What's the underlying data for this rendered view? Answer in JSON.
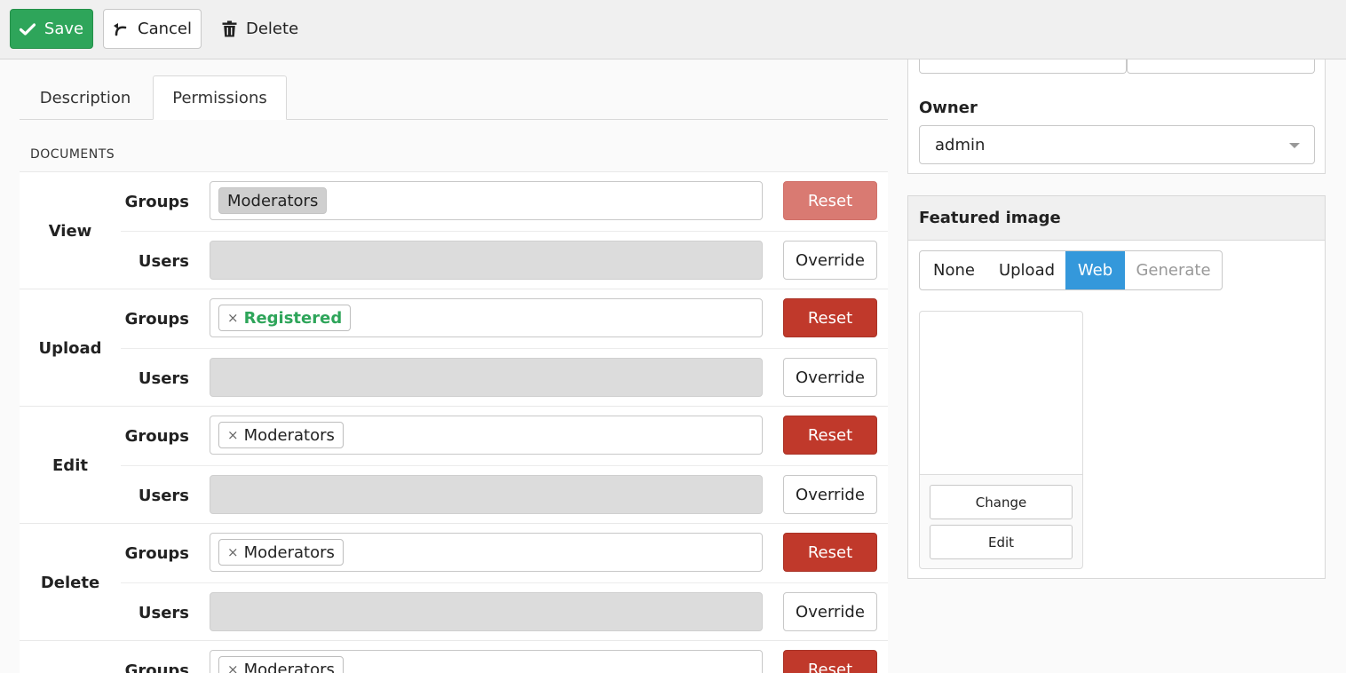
{
  "toolbar": {
    "save_label": "Save",
    "cancel_label": "Cancel",
    "delete_label": "Delete"
  },
  "tabs": [
    {
      "label": "Description",
      "active": false
    },
    {
      "label": "Permissions",
      "active": true
    }
  ],
  "section": {
    "label": "DOCUMENTS"
  },
  "labels": {
    "groups": "Groups",
    "users": "Users"
  },
  "permissions": [
    {
      "action": "View",
      "group_chip": "Moderators",
      "chip_removable": false,
      "reset_label": "Reset",
      "override_label": "Override"
    },
    {
      "action": "Upload",
      "group_chip": "Registered",
      "chip_removable": true,
      "reset_label": "Reset",
      "override_label": "Override"
    },
    {
      "action": "Edit",
      "group_chip": "Moderators",
      "chip_removable": true,
      "reset_label": "Reset",
      "override_label": "Override"
    },
    {
      "action": "Delete",
      "group_chip": "Moderators",
      "chip_removable": true,
      "reset_label": "Reset",
      "override_label": "Override"
    },
    {
      "action": "",
      "group_chip": "Moderators",
      "chip_removable": true,
      "reset_label": "Reset",
      "override_label": ""
    }
  ],
  "chip_remove_glyph": "×",
  "sidebar": {
    "owner": {
      "label": "Owner",
      "value": "admin"
    },
    "featured_image": {
      "title": "Featured image",
      "sources": [
        {
          "label": "None",
          "state": "normal"
        },
        {
          "label": "Upload",
          "state": "normal"
        },
        {
          "label": "Web",
          "state": "active"
        },
        {
          "label": "Generate",
          "state": "disabled"
        }
      ],
      "change_label": "Change",
      "edit_label": "Edit"
    }
  },
  "colors": {
    "save": "#2ea55a",
    "reset": "#c0392b",
    "reset_disabled": "#d97a72",
    "active_segment": "#3498db",
    "registered_chip_text": "#2ea55a"
  }
}
